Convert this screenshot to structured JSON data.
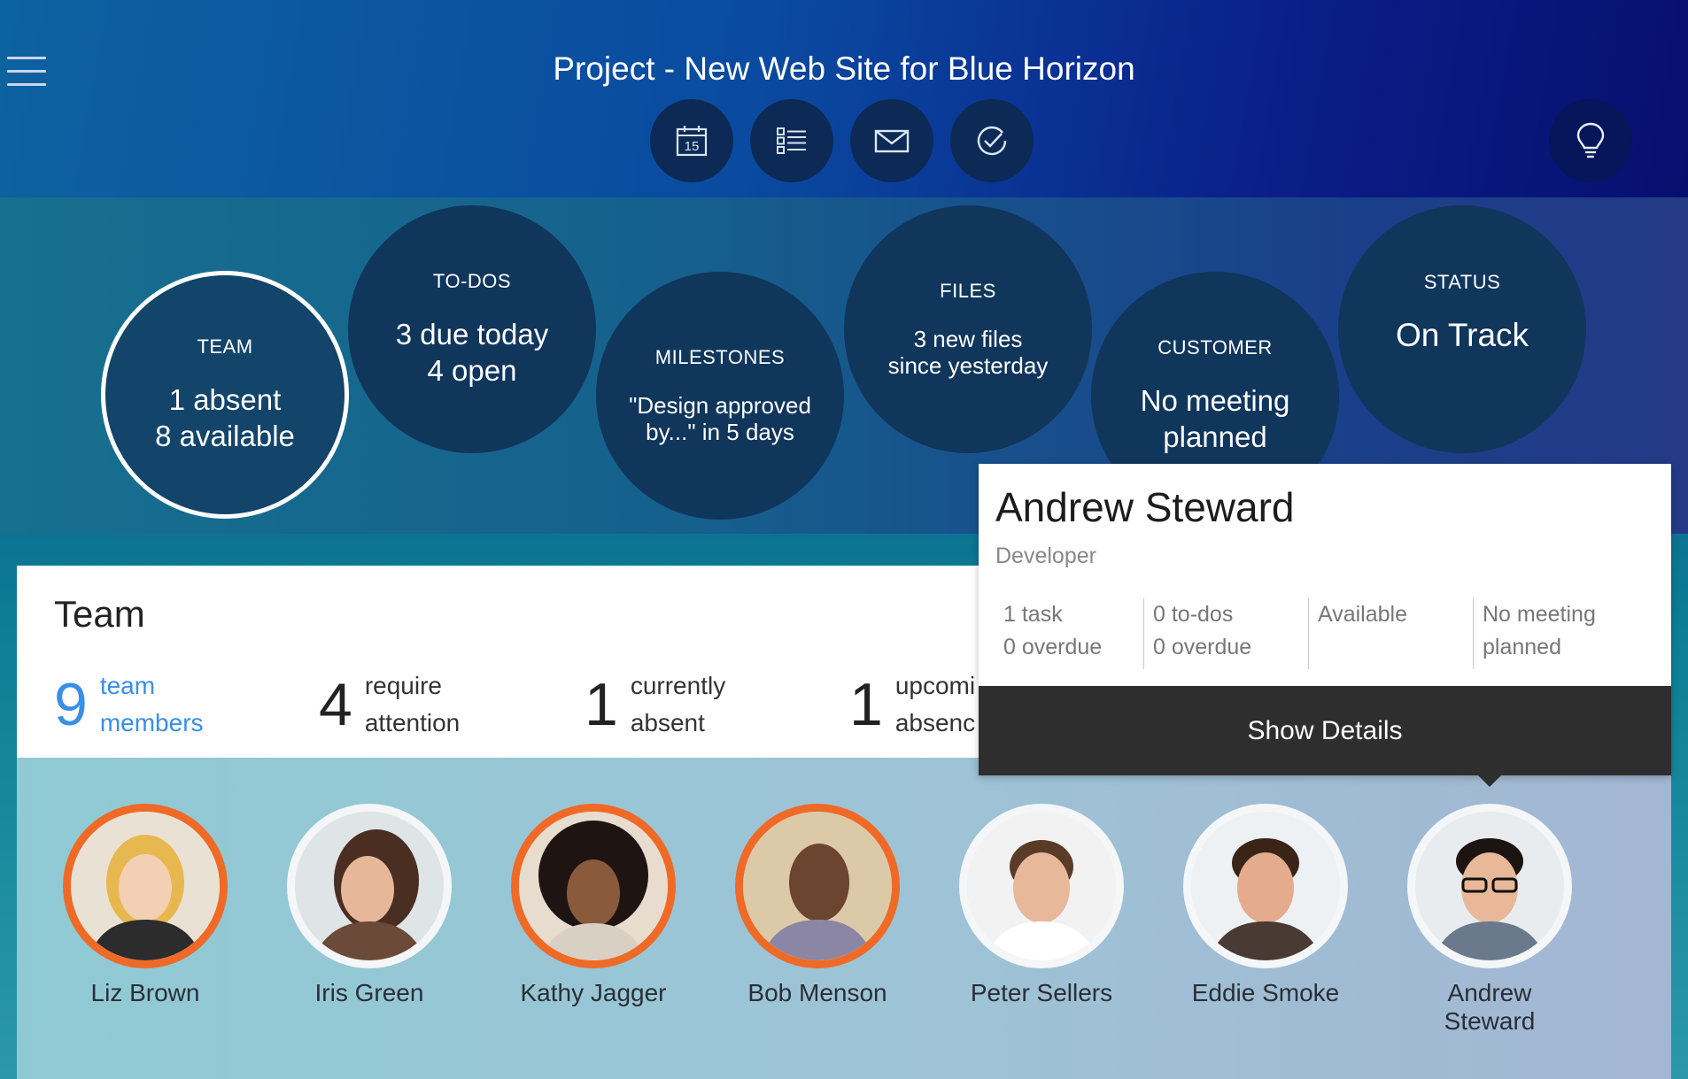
{
  "header": {
    "title": "Project - New Web Site for Blue Horizon",
    "calendar_day": "15",
    "tool_icons": [
      "calendar-icon",
      "list-icon",
      "mail-icon",
      "check-icon"
    ],
    "help_icon": "lightbulb-icon"
  },
  "tiles": {
    "team": {
      "label": "TEAM",
      "line1": "1 absent",
      "line2": "8 available"
    },
    "todos": {
      "label": "TO-DOS",
      "line1": "3 due today",
      "line2": "4 open"
    },
    "milestones": {
      "label": "MILESTONES",
      "line1": "\"Design approved",
      "line2": "by...\" in 5 days"
    },
    "files": {
      "label": "FILES",
      "line1": "3 new files",
      "line2": "since yesterday"
    },
    "customer": {
      "label": "CUSTOMER",
      "line1": "No meeting",
      "line2": "planned"
    },
    "status": {
      "label": "STATUS",
      "line1": "On Track"
    }
  },
  "team_panel": {
    "title": "Team",
    "stats": [
      {
        "num": "9",
        "line1": "team",
        "line2": "members"
      },
      {
        "num": "4",
        "line1": "require",
        "line2": "attention"
      },
      {
        "num": "1",
        "line1": "currently",
        "line2": "absent"
      },
      {
        "num": "1",
        "line1": "upcomi",
        "line2": "absenc"
      }
    ]
  },
  "members": [
    {
      "name": "Liz Brown",
      "alert": true
    },
    {
      "name": "Iris Green",
      "alert": false
    },
    {
      "name": "Kathy Jagger",
      "alert": true
    },
    {
      "name": "Bob Menson",
      "alert": true
    },
    {
      "name": "Peter Sellers",
      "alert": false
    },
    {
      "name": "Eddie Smoke",
      "alert": false
    },
    {
      "name": "Andrew Steward",
      "name_line1": "Andrew",
      "name_line2": "Steward",
      "alert": false
    }
  ],
  "popover": {
    "name": "Andrew Steward",
    "role": "Developer",
    "stats": [
      {
        "line1": "1 task",
        "line2": "0 overdue"
      },
      {
        "line1": "0 to-dos",
        "line2": "0 overdue"
      },
      {
        "line1": "Available",
        "line2": ""
      },
      {
        "line1": "No meeting",
        "line2": "planned"
      }
    ],
    "button": "Show Details"
  },
  "colors": {
    "alert_ring": "#ef6a26",
    "accent_blue": "#3a8ee6",
    "tile_bg": "#10365c"
  }
}
